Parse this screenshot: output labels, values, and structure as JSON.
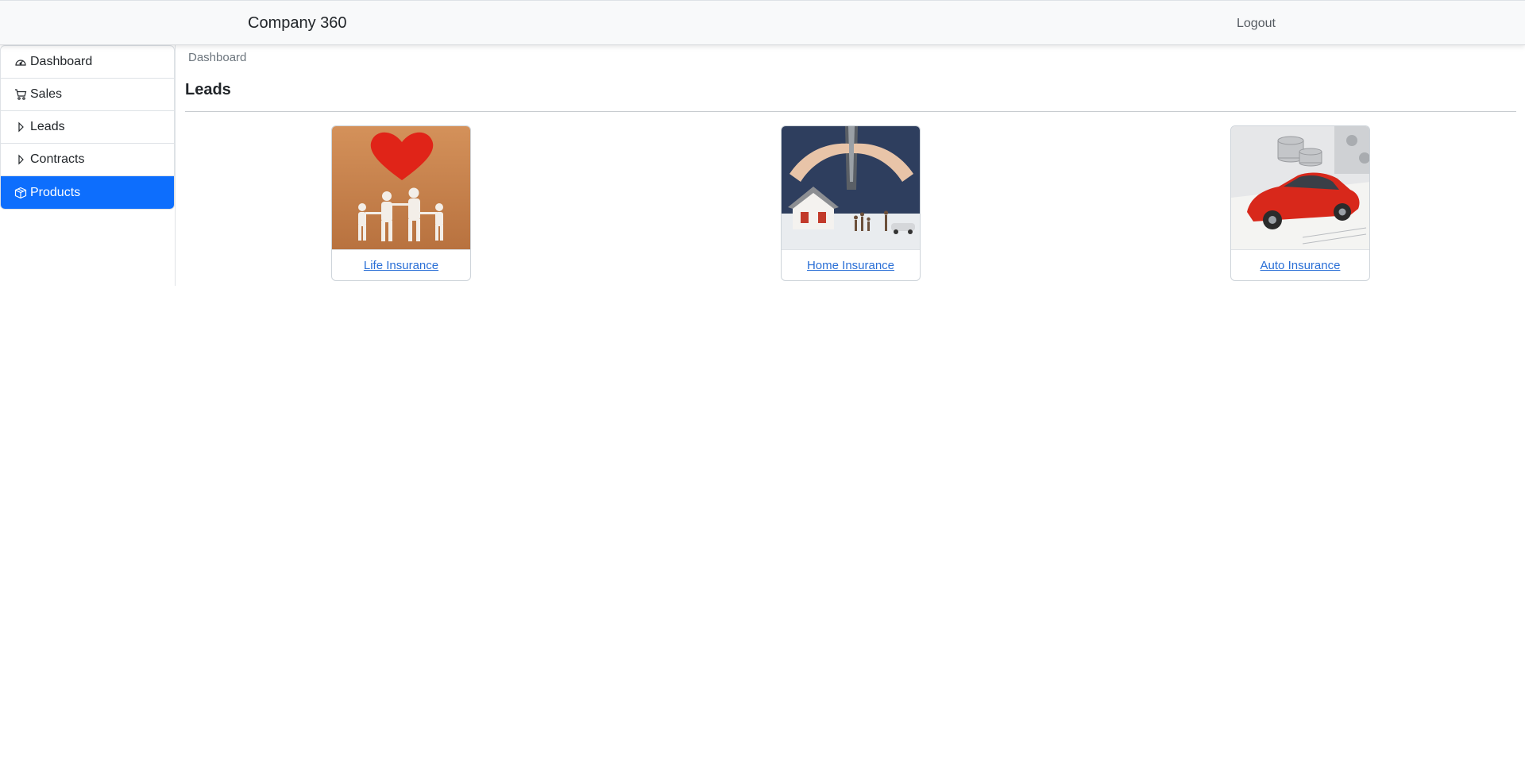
{
  "header": {
    "brand": "Company 360",
    "logout_label": "Logout"
  },
  "sidebar": {
    "items": [
      {
        "label": "Dashboard",
        "icon": "speedometer-icon",
        "active": false
      },
      {
        "label": "Sales",
        "icon": "cart-icon",
        "active": false
      },
      {
        "label": "Leads",
        "icon": "caret-right-icon",
        "active": false
      },
      {
        "label": "Contracts",
        "icon": "caret-right-icon",
        "active": false
      },
      {
        "label": "Products",
        "icon": "box-icon",
        "active": true
      }
    ],
    "active_color": "#0d6efd"
  },
  "main": {
    "breadcrumb": "Dashboard",
    "title": "Leads",
    "products": [
      {
        "label": "Life Insurance",
        "image": "family-heart-image"
      },
      {
        "label": "Home Insurance",
        "image": "house-hands-image"
      },
      {
        "label": "Auto Insurance",
        "image": "red-car-coins-image"
      }
    ]
  }
}
